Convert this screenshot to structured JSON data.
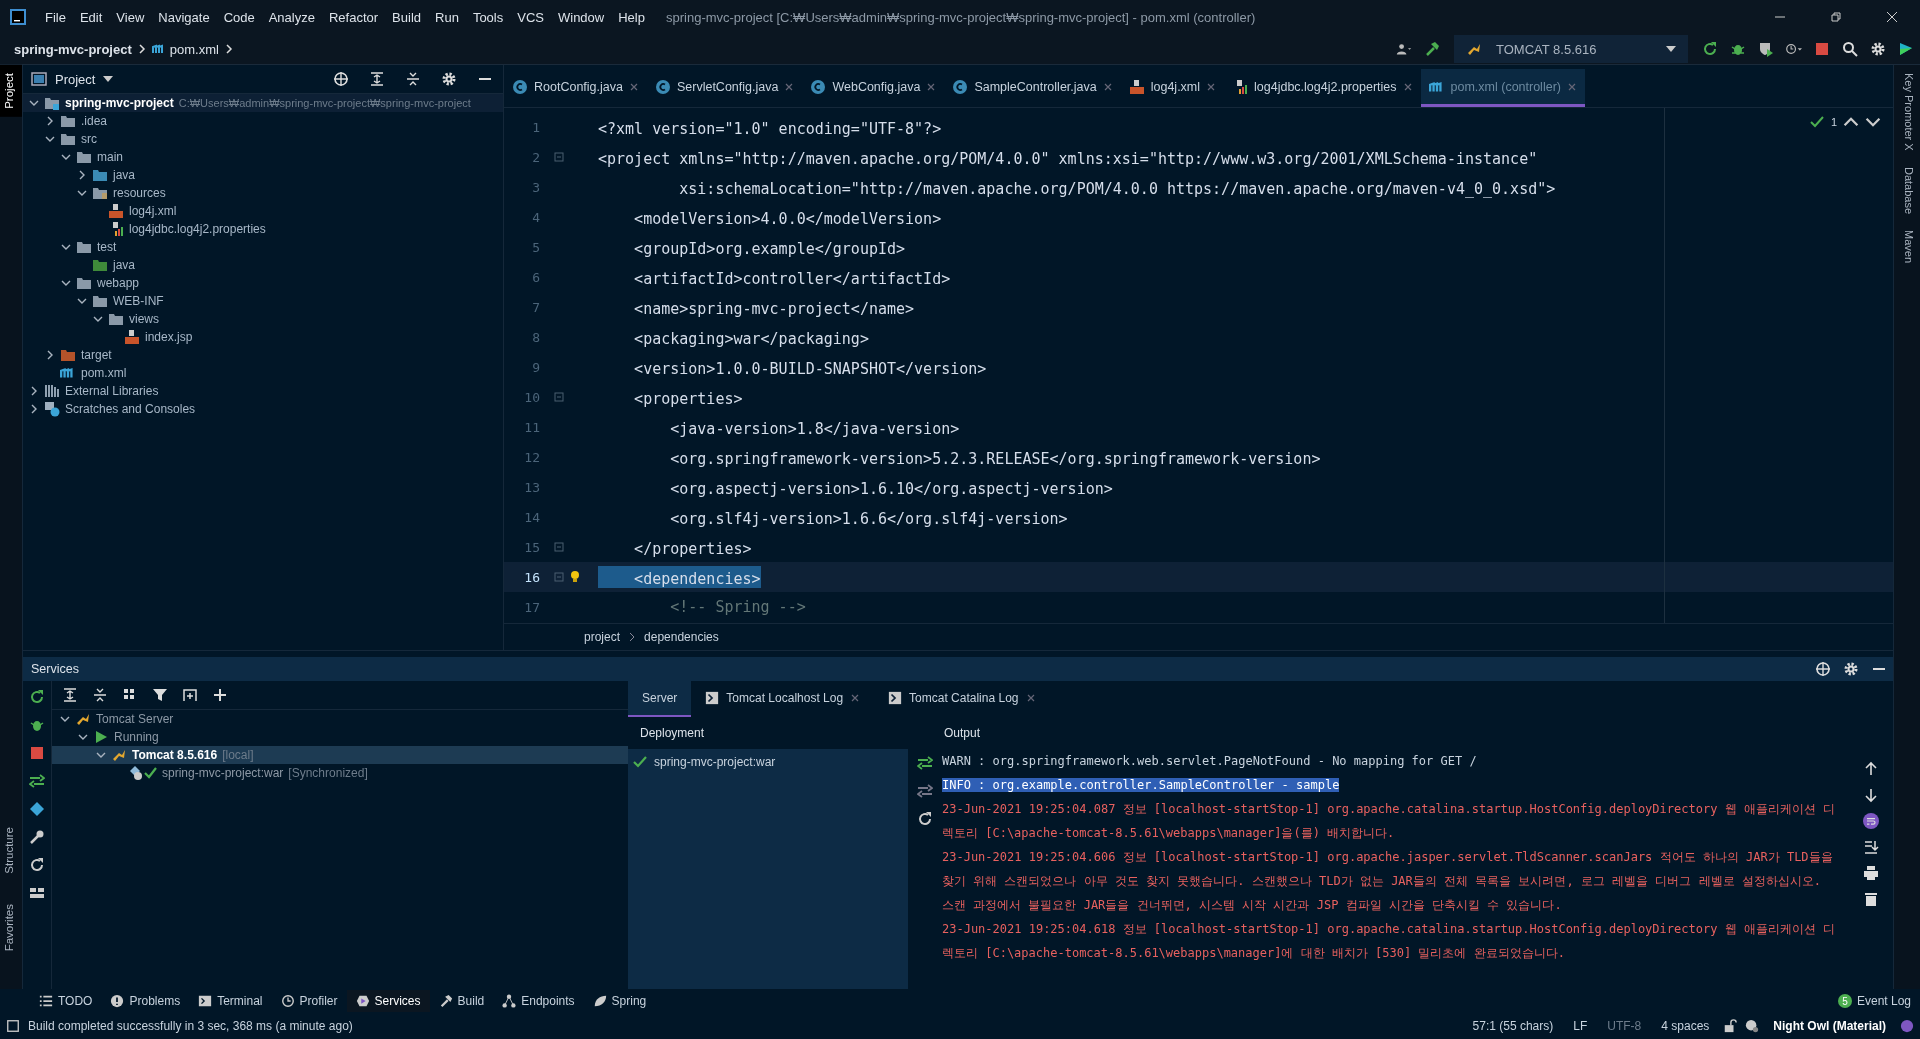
{
  "menu_bar": {
    "items": [
      "File",
      "Edit",
      "View",
      "Navigate",
      "Code",
      "Analyze",
      "Refactor",
      "Build",
      "Run",
      "Tools",
      "VCS",
      "Window",
      "Help"
    ],
    "title": "spring-mvc-project [C:₩Users₩admin₩spring-mvc-project₩spring-mvc-project] - pom.xml (controller)"
  },
  "nav_bar": {
    "crumbs": [
      "spring-mvc-project",
      "pom.xml"
    ],
    "run_config": "TOMCAT 8.5.616"
  },
  "left_stripe": [
    {
      "label": "Project",
      "selected": true
    },
    {
      "label": "Structure",
      "selected": false
    },
    {
      "label": "Favorites",
      "selected": false
    }
  ],
  "right_stripe": [
    "Key Promoter X",
    "Database",
    "Maven"
  ],
  "project": {
    "title": "Project",
    "tree": [
      {
        "label": "spring-mvc-project",
        "path": "C:₩Users₩admin₩spring-mvc-project₩spring-mvc-project",
        "kind": "module",
        "expanded": true,
        "children": [
          {
            "label": ".idea",
            "kind": "folder",
            "expanded": false
          },
          {
            "label": "src",
            "kind": "folder",
            "expanded": true,
            "children": [
              {
                "label": "main",
                "kind": "folder",
                "expanded": true,
                "children": [
                  {
                    "label": "java",
                    "kind": "source-folder",
                    "expanded": false
                  },
                  {
                    "label": "resources",
                    "kind": "resource-folder",
                    "expanded": true,
                    "children": [
                      {
                        "label": "log4j.xml",
                        "kind": "xml"
                      },
                      {
                        "label": "log4jdbc.log4j2.properties",
                        "kind": "properties"
                      }
                    ]
                  }
                ]
              },
              {
                "label": "test",
                "kind": "folder",
                "expanded": true,
                "children": [
                  {
                    "label": "java",
                    "kind": "test-folder"
                  }
                ]
              },
              {
                "label": "webapp",
                "kind": "folder",
                "expanded": true,
                "children": [
                  {
                    "label": "WEB-INF",
                    "kind": "folder",
                    "expanded": true,
                    "children": [
                      {
                        "label": "views",
                        "kind": "folder",
                        "expanded": true,
                        "children": [
                          {
                            "label": "index.jsp",
                            "kind": "jsp"
                          }
                        ]
                      }
                    ]
                  }
                ]
              }
            ]
          },
          {
            "label": "target",
            "kind": "excluded-folder",
            "expanded": false
          },
          {
            "label": "pom.xml",
            "kind": "maven"
          }
        ]
      },
      {
        "label": "External Libraries",
        "kind": "libraries",
        "expanded": false
      },
      {
        "label": "Scratches and Consoles",
        "kind": "scratches",
        "expanded": false
      }
    ]
  },
  "editor": {
    "tabs": [
      {
        "label": "RootConfig.java",
        "kind": "class",
        "selected": false
      },
      {
        "label": "ServletConfig.java",
        "kind": "class",
        "selected": false
      },
      {
        "label": "WebConfig.java",
        "kind": "class",
        "selected": false
      },
      {
        "label": "SampleController.java",
        "kind": "class",
        "selected": false
      },
      {
        "label": "log4j.xml",
        "kind": "xml",
        "selected": false
      },
      {
        "label": "log4jdbc.log4j2.properties",
        "kind": "properties",
        "selected": false
      },
      {
        "label": "pom.xml (controller)",
        "kind": "maven",
        "selected": true
      }
    ],
    "inspection_count": "1",
    "lines": [
      {
        "number": "1",
        "text": "<?xml version=\"1.0\" encoding=\"UTF-8\"?>",
        "kind": "code",
        "fold": false,
        "current": false
      },
      {
        "number": "2",
        "text": "<project xmlns=\"http://maven.apache.org/POM/4.0.0\" xmlns:xsi=\"http://www.w3.org/2001/XMLSchema-instance\"",
        "kind": "code",
        "fold": true,
        "current": false
      },
      {
        "number": "3",
        "text": "         xsi:schemaLocation=\"http://maven.apache.org/POM/4.0.0 https://maven.apache.org/maven-v4_0_0.xsd\">",
        "kind": "code",
        "fold": false,
        "current": false
      },
      {
        "number": "4",
        "text": "    <modelVersion>4.0.0</modelVersion>",
        "kind": "code",
        "fold": false,
        "current": false
      },
      {
        "number": "5",
        "text": "    <groupId>org.example</groupId>",
        "kind": "code",
        "fold": false,
        "current": false
      },
      {
        "number": "6",
        "text": "    <artifactId>controller</artifactId>",
        "kind": "code",
        "fold": false,
        "current": false
      },
      {
        "number": "7",
        "text": "    <name>spring-mvc-project</name>",
        "kind": "code",
        "fold": false,
        "current": false
      },
      {
        "number": "8",
        "text": "    <packaging>war</packaging>",
        "kind": "code",
        "fold": false,
        "current": false
      },
      {
        "number": "9",
        "text": "    <version>1.0.0-BUILD-SNAPSHOT</version>",
        "kind": "code",
        "fold": false,
        "current": false
      },
      {
        "number": "10",
        "text": "    <properties>",
        "kind": "code",
        "fold": true,
        "current": false
      },
      {
        "number": "11",
        "text": "        <java-version>1.8</java-version>",
        "kind": "code",
        "fold": false,
        "current": false
      },
      {
        "number": "12",
        "text": "        <org.springframework-version>5.2.3.RELEASE</org.springframework-version>",
        "kind": "code",
        "fold": false,
        "current": false
      },
      {
        "number": "13",
        "text": "        <org.aspectj-version>1.6.10</org.aspectj-version>",
        "kind": "code",
        "fold": false,
        "current": false
      },
      {
        "number": "14",
        "text": "        <org.slf4j-version>1.6.6</org.slf4j-version>",
        "kind": "code",
        "fold": false,
        "current": false
      },
      {
        "number": "15",
        "text": "    </properties>",
        "kind": "code",
        "fold": true,
        "current": false
      },
      {
        "number": "16",
        "text": "    <dependencies>",
        "kind": "code",
        "fold": true,
        "current": true
      },
      {
        "number": "17",
        "text": "        <!-- Spring -->",
        "kind": "comment",
        "fold": false,
        "current": false
      }
    ],
    "breadcrumb": [
      "project",
      "dependencies"
    ]
  },
  "services": {
    "title": "Services",
    "tree": [
      {
        "label": "Tomcat Server",
        "kind": "tomcat",
        "selected": false,
        "expanded": true,
        "children": [
          {
            "label": "Running",
            "kind": "run",
            "selected": false,
            "expanded": true,
            "children": [
              {
                "label": "Tomcat 8.5.616",
                "note": "[local]",
                "kind": "tomcat",
                "selected": true,
                "expanded": true,
                "children": [
                  {
                    "label": "spring-mvc-project:war",
                    "note": "[Synchronized]",
                    "kind": "artifact",
                    "selected": false
                  }
                ]
              }
            ]
          }
        ]
      }
    ],
    "tabs": [
      {
        "label": "Server",
        "kind": "plain",
        "closable": false,
        "selected": true
      },
      {
        "label": "Tomcat Localhost Log",
        "kind": "console",
        "closable": true,
        "selected": false
      },
      {
        "label": "Tomcat Catalina Log",
        "kind": "console",
        "closable": true,
        "selected": false
      }
    ],
    "deployment": {
      "title": "Deployment",
      "items": [
        "spring-mvc-project:war"
      ]
    },
    "output": {
      "title": "Output",
      "lines": [
        {
          "kind": "warn",
          "selected": false,
          "text": "WARN : org.springframework.web.servlet.PageNotFound - No mapping for GET /"
        },
        {
          "kind": "info",
          "selected": true,
          "text": "INFO : org.example.controller.SampleController - sample"
        },
        {
          "kind": "error",
          "selected": false,
          "text": "23-Jun-2021 19:25:04.087 정보 [localhost-startStop-1] org.apache.catalina.startup.HostConfig.deployDirectory 웹 애플리케이션 디렉토리 [C:\\apache-tomcat-8.5.61\\webapps\\manager]을(를) 배치합니다."
        },
        {
          "kind": "error",
          "selected": false,
          "text": "23-Jun-2021 19:25:04.606 정보 [localhost-startStop-1] org.apache.jasper.servlet.TldScanner.scanJars 적어도 하나의 JAR가 TLD들을 찾기 위해 스캔되었으나 아무 것도 찾지 못했습니다. 스캔했으나 TLD가 없는 JAR들의 전체 목록을 보시려면, 로그 레벨을 디버그 레벨로 설정하십시오. 스캔 과정에서 불필요한 JAR들을 건너뛰면, 시스템 시작 시간과 JSP 컴파일 시간을 단축시킬 수 있습니다."
        },
        {
          "kind": "error",
          "selected": false,
          "text": "23-Jun-2021 19:25:04.618 정보 [localhost-startStop-1] org.apache.catalina.startup.HostConfig.deployDirectory 웹 애플리케이션 디렉토리 [C:\\apache-tomcat-8.5.61\\webapps\\manager]에 대한 배치가 [530] 밀리초에 완료되었습니다."
        }
      ]
    }
  },
  "tool_windows": [
    {
      "label": "TODO",
      "kind": "list",
      "selected": false
    },
    {
      "label": "Problems",
      "kind": "problems",
      "selected": false
    },
    {
      "label": "Terminal",
      "kind": "terminal",
      "selected": false
    },
    {
      "label": "Profiler",
      "kind": "profiler",
      "selected": false
    },
    {
      "label": "Services",
      "kind": "services",
      "selected": true
    },
    {
      "label": "Build",
      "kind": "hammer",
      "selected": false
    },
    {
      "label": "Endpoints",
      "kind": "endpoints",
      "selected": false
    },
    {
      "label": "Spring",
      "kind": "spring",
      "selected": false
    }
  ],
  "event_log": {
    "label": "Event Log",
    "count": "5"
  },
  "status_bar": {
    "message": "Build completed successfully in 3 sec, 368 ms (a minute ago)",
    "position": "57:1 (55 chars)",
    "line_separator": "LF",
    "encoding": "UTF-8",
    "indent": "4 spaces",
    "theme": "Night Owl (Material)"
  }
}
